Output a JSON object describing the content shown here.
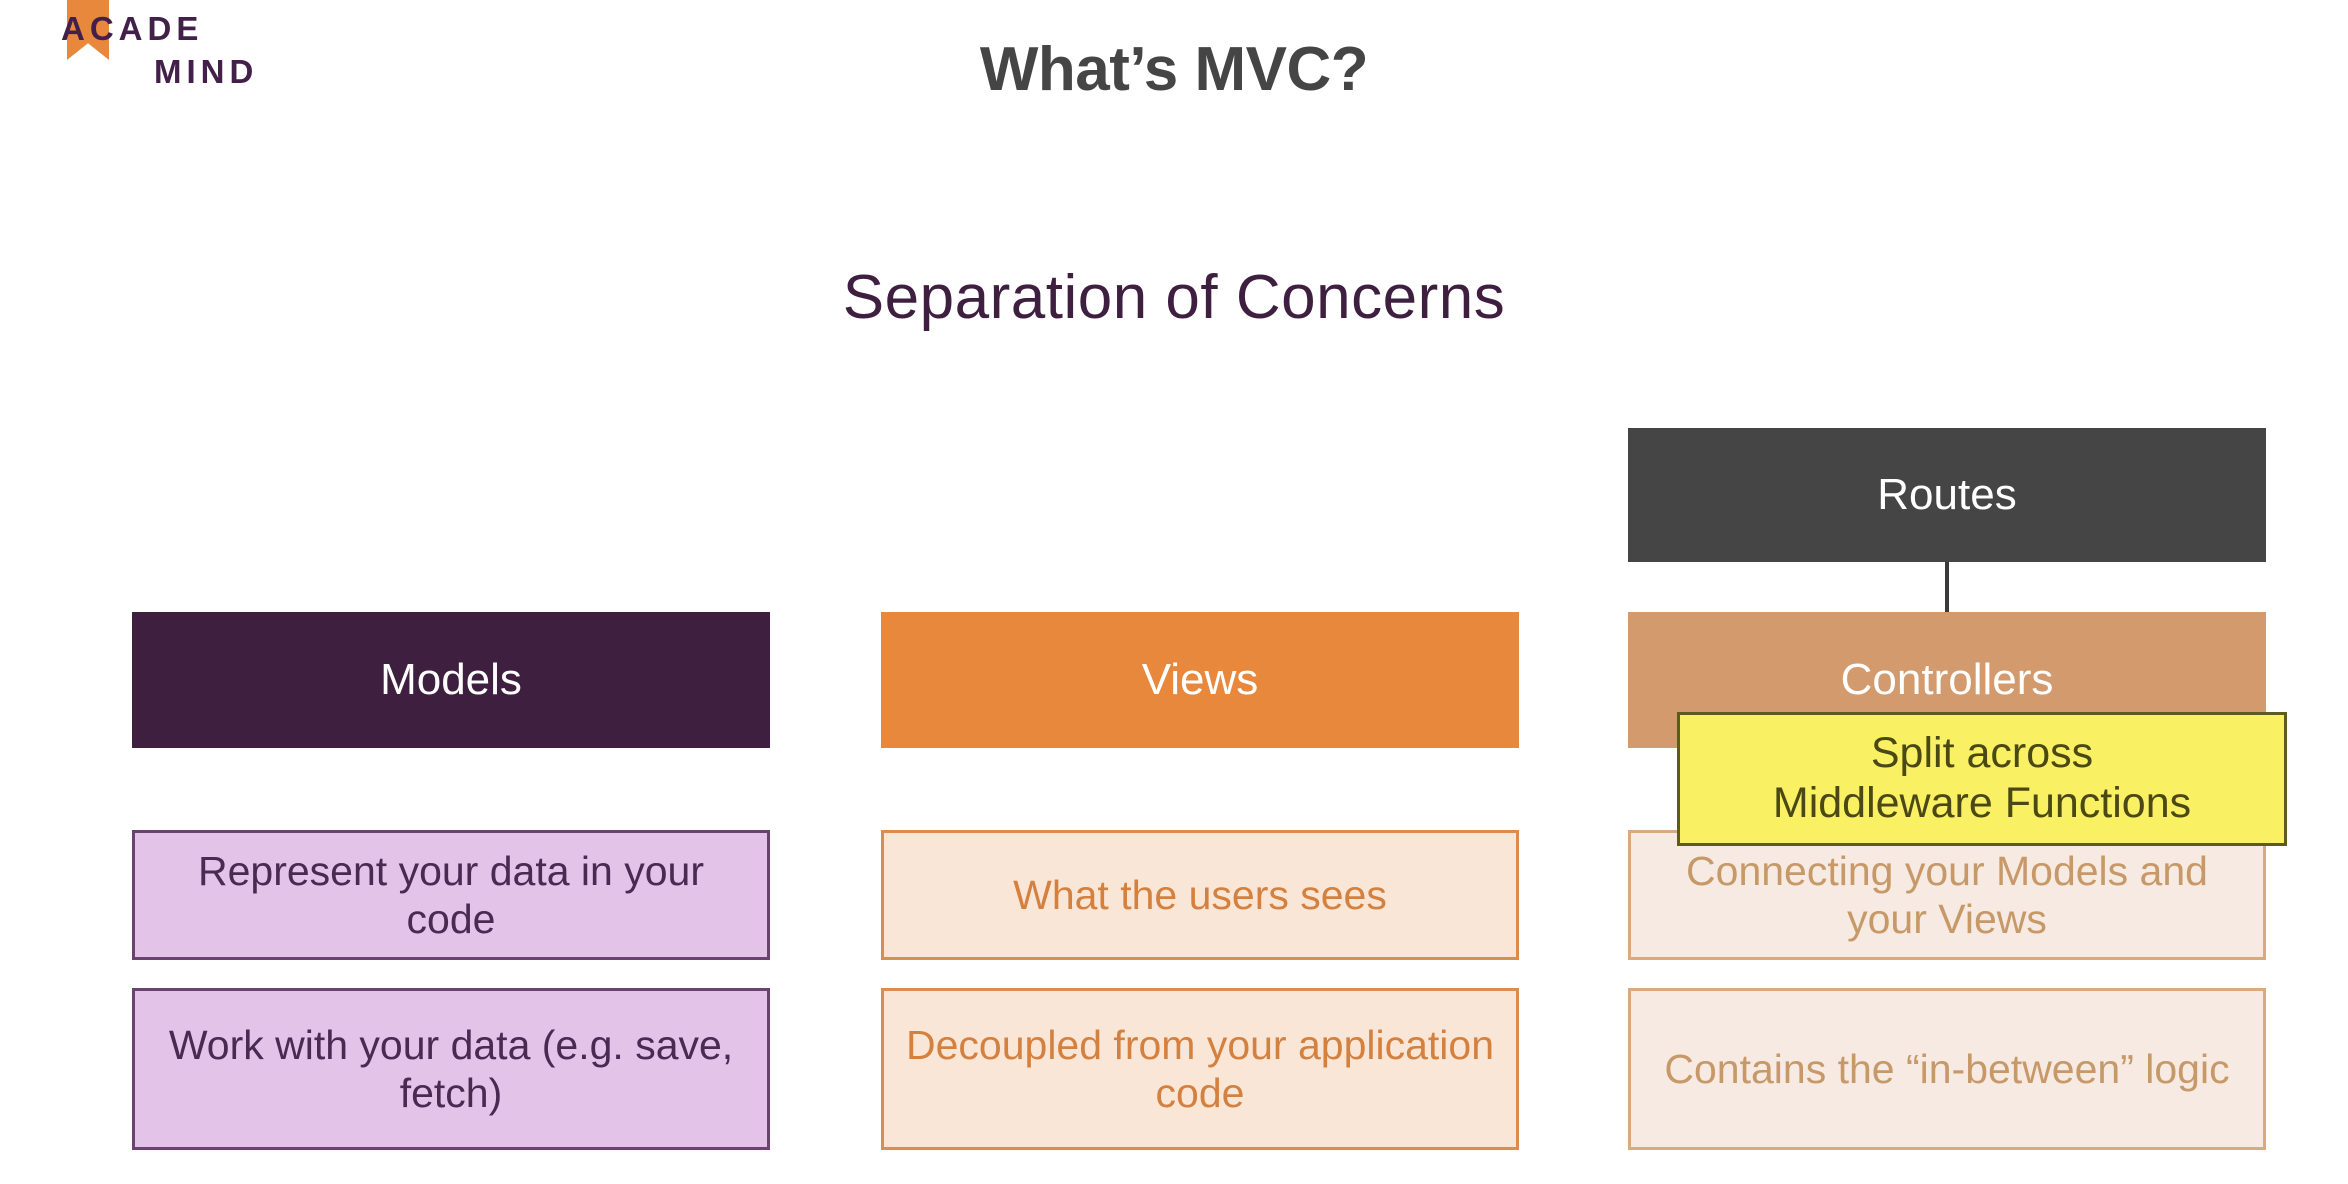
{
  "logo": {
    "line1": "ACADE",
    "line2": "MIND",
    "mark_name": "bookmark-mark",
    "mark_color": "#E8883C",
    "text_color": "#43204A"
  },
  "slide": {
    "title": "What’s MVC?",
    "subtitle": "Separation of Concerns",
    "title_color": "#454545",
    "subtitle_color": "#3E1F40"
  },
  "routes": {
    "label": "Routes",
    "color": "#454545"
  },
  "columns": [
    {
      "key": "models",
      "header": "Models",
      "header_color": "#3E1F40",
      "box_fill": "#E3C3E8",
      "box_border": "#6B4370",
      "details": [
        "Represent your data in your code",
        "Work with your data (e.g. save, fetch)"
      ]
    },
    {
      "key": "views",
      "header": "Views",
      "header_color": "#E8883C",
      "box_fill": "#FAE6D7",
      "box_border": "#DB8C4E",
      "details": [
        "What the users sees",
        "Decoupled from your application code"
      ]
    },
    {
      "key": "controllers",
      "header": "Controllers",
      "header_color": "#D39A6E",
      "box_fill": "#F6EAE2",
      "box_border": "#D9A97F",
      "details": [
        "Connecting your Models and your Views",
        "Contains the “in-between” logic"
      ]
    }
  ],
  "sticky_note": {
    "line1": "Split across",
    "line2": "Middleware Functions",
    "fill": "#FAF063",
    "border": "#5E5C1C"
  }
}
